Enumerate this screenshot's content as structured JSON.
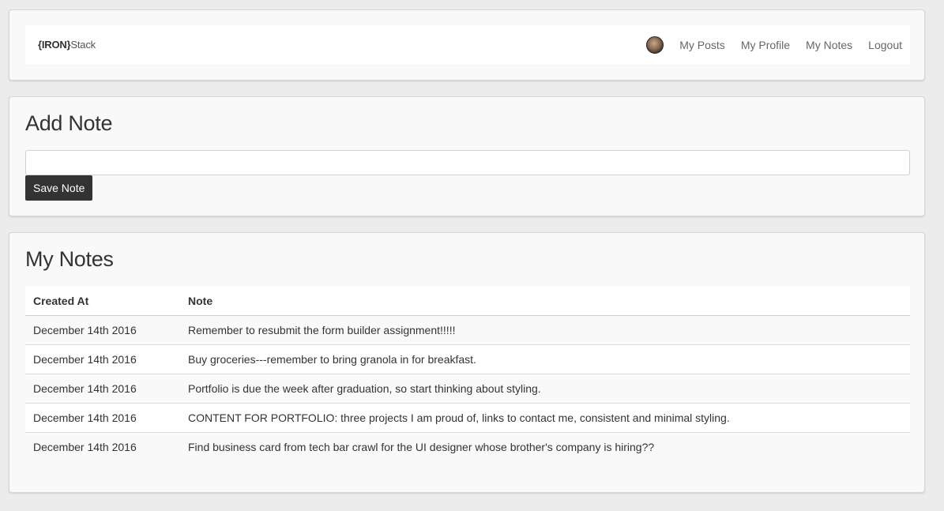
{
  "navbar": {
    "brand_bold": "{IRON}",
    "brand_rest": "Stack",
    "links": [
      "My Posts",
      "My Profile",
      "My Notes",
      "Logout"
    ],
    "avatar_icon": "user-avatar-photo"
  },
  "add_note": {
    "title": "Add Note",
    "input_value": "",
    "save_label": "Save Note"
  },
  "my_notes": {
    "title": "My Notes",
    "columns": [
      "Created At",
      "Note"
    ],
    "rows": [
      {
        "created_at": "December 14th 2016",
        "note": "Remember to resubmit the form builder assignment!!!!!"
      },
      {
        "created_at": "December 14th 2016",
        "note": "Buy groceries---remember to bring granola in for breakfast."
      },
      {
        "created_at": "December 14th 2016",
        "note": "Portfolio is due the week after graduation, so start thinking about styling."
      },
      {
        "created_at": "December 14th 2016",
        "note": "CONTENT FOR PORTFOLIO: three projects I am proud of, links to contact me, consistent and minimal styling."
      },
      {
        "created_at": "December 14th 2016",
        "note": "Find business card from tech bar crawl for the UI designer whose brother's company is hiring??"
      }
    ]
  },
  "colors": {
    "background": "#ececec",
    "panel": "#f9f9f9",
    "button": "#333333"
  }
}
